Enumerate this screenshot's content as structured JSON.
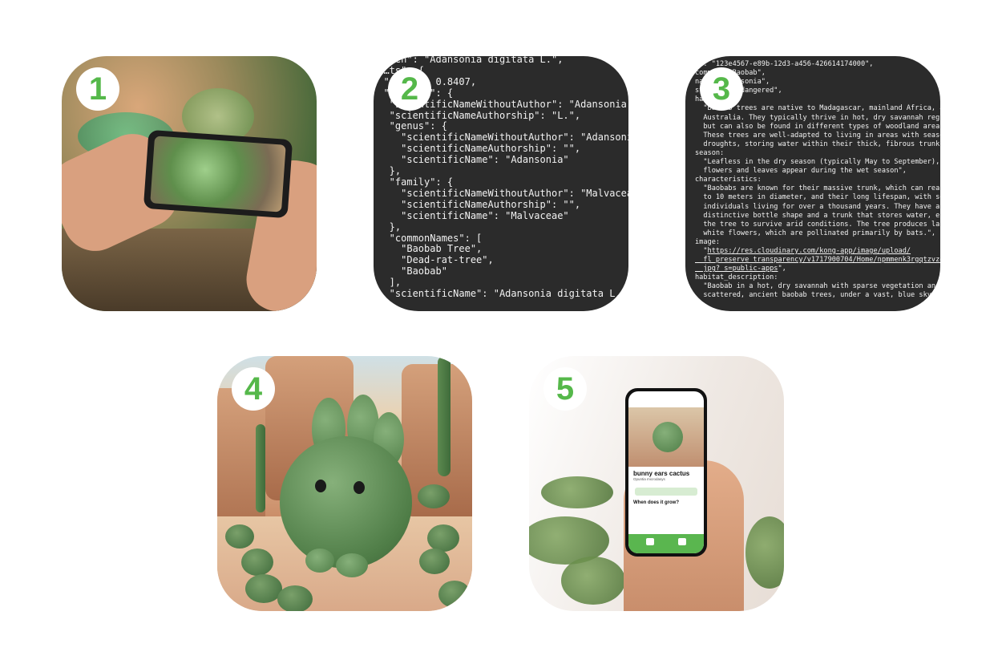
{
  "badges": [
    "1",
    "2",
    "3",
    "4",
    "5"
  ],
  "accent_color": "#55b84a",
  "code_background": "#2b2b2b",
  "tile2_code": "  \"…en\": \"Adansonia digitata L.\",\n  …ts\": {\n  \"score\": 0.8407,\n  \"species\": {\n   \"scientificNameWithoutAuthor\": \"Adansonia digitata\n   \"scientificNameAuthorship\": \"L.\",\n   \"genus\": {\n     \"scientificNameWithoutAuthor\": \"Adansonia\",\n     \"scientificNameAuthorship\": \"\",\n     \"scientificName\": \"Adansonia\"\n   },\n   \"family\": {\n     \"scientificNameWithoutAuthor\": \"Malvaceae\",\n     \"scientificNameAuthorship\": \"\",\n     \"scientificName\": \"Malvaceae\"\n   },\n   \"commonNames\": [\n     \"Baobab Tree\",\n     \"Dead-rat-tree\",\n     \"Baobab\"\n   ],\n   \"scientificName\": \"Adansonia digitata L.\"",
  "tile3_code_pre": "id: \"123e4567-e89b-12d3-a456-426614174000\",\ncommon: \"Baobab\",\nname: \"Adansonia\",\nstatus: \"Endangered\",\nhabitat:\n  \"Baobab trees are native to Madagascar, mainland Africa, and\n  Australia. They typically thrive in hot, dry savannah regions\n  but can also be found in different types of woodland areas.\n  These trees are well-adapted to living in areas with seasonal\n  droughts, storing water within their thick, fibrous trunk.\",\nseason:\n  \"Leafless in the dry season (typically May to September),\n  flowers and leaves appear during the wet season\",\ncharacteristics:\n  \"Baobabs are known for their massive trunk, which can reach up\n  to 10 meters in diameter, and their long lifespan, with some\n  individuals living for over a thousand years. They have a\n  distinctive bottle shape and a trunk that stores water, enabling\n  the tree to survive arid conditions. The tree produces large\n  white flowers, which are pollinated primarily by bats.\",\nimage:\n  \"",
  "tile3_link": "https://res.cloudinary.com/kong-app/image/upload/\n  fl_preserve_transparency/v1717900704/Home/npmmenk3rgqtzvzqdvrc.\n  jpg?_s=public-apps",
  "tile3_code_post": "\",\nhabitat_description:\n  \"Baobab in a hot, dry savannah with sparse vegetation and\n  scattered, ancient baobab trees, under a vast, blue sky.\",",
  "phone_app": {
    "plant_name": "bunny ears cactus",
    "scientific_name": "Opuntia microdasys",
    "section_title": "When does it grow?"
  }
}
